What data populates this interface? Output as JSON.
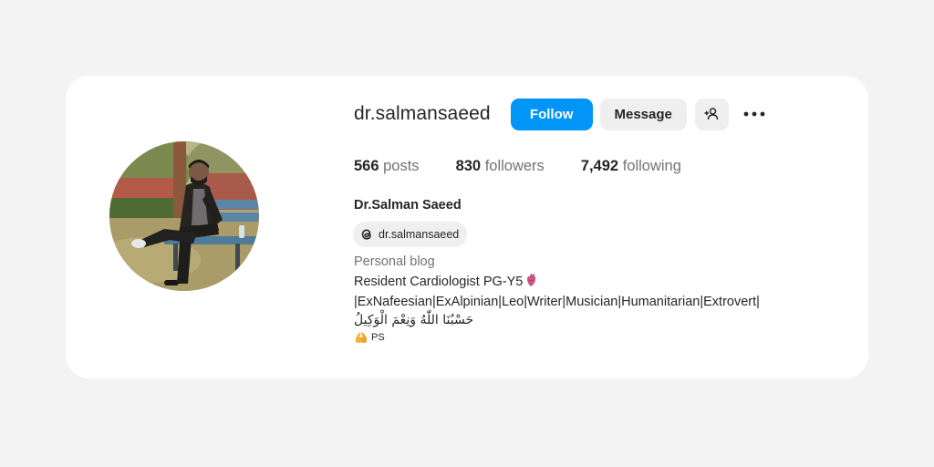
{
  "profile": {
    "username": "dr.salmansaeed",
    "follow_label": "Follow",
    "message_label": "Message",
    "suggest_icon": "person-add-icon",
    "more_icon": "more-dots-icon",
    "posts_count": "566",
    "posts_label": "posts",
    "followers_count": "830",
    "followers_label": "followers",
    "following_count": "7,492",
    "following_label": "following",
    "full_name": "Dr.Salman Saeed",
    "threads_handle": "dr.salmansaeed",
    "threads_icon": "threads-icon",
    "category": "Personal blog",
    "bio": {
      "line1": "Resident Cardiologist PG-Y5",
      "line1_emoji": "anatomical-heart-icon",
      "line2": "|ExNafeesian|ExAlpinian|Leo|Writer|Musician|Humanitarian|Extrovert|",
      "line3": "حَسْبُنَا اللّٰهُ وَنِعْمَ الْوَكِيلُ",
      "line4_emoji": "folded-hands-icon",
      "line4": "PS"
    }
  },
  "colors": {
    "page_bg": "#f3f3f3",
    "card_bg": "#ffffff",
    "primary": "#0095f6",
    "secondary_btn": "#efefef",
    "muted_text": "#737373",
    "text": "#262626"
  }
}
